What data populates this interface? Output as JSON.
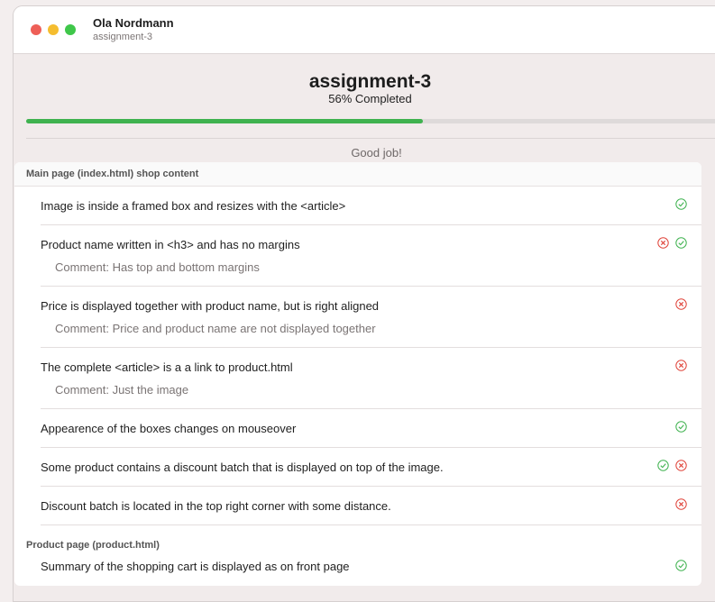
{
  "window": {
    "user_name": "Ola Nordmann",
    "assignment_id": "assignment-3"
  },
  "header": {
    "title": "assignment-3",
    "progress_text": "56% Completed",
    "progress_fraction": 0.56,
    "feedback": "Good job!"
  },
  "colors": {
    "progress_fill": "#3fb24f",
    "check_green": "#3fb24f",
    "cross_red": "#e0443a"
  },
  "sections": [
    {
      "title": "Main page (index.html) shop content",
      "criteria": [
        {
          "text": "Image is inside a framed box and resizes with the <article>",
          "comment": "",
          "icons": [
            "check-icon"
          ]
        },
        {
          "text": "Product name written in <h3> and has no margins",
          "comment": "Comment: Has top and bottom margins",
          "icons": [
            "cross-icon",
            "check-icon"
          ]
        },
        {
          "text": "Price is displayed together with product name, but is right aligned",
          "comment": "Comment: Price and product name are not displayed together",
          "icons": [
            "cross-icon"
          ]
        },
        {
          "text": "The complete <article> is a a link to product.html",
          "comment": "Comment: Just the image",
          "icons": [
            "cross-icon"
          ]
        },
        {
          "text": "Appearence of the boxes changes on mouseover",
          "comment": "",
          "icons": [
            "check-icon"
          ]
        },
        {
          "text": "Some product contains a discount batch that is displayed on top of the image.",
          "comment": "",
          "icons": [
            "check-icon",
            "cross-icon"
          ]
        },
        {
          "text": "Discount batch is located in the top right corner with some distance.",
          "comment": "",
          "icons": [
            "cross-icon"
          ]
        }
      ]
    },
    {
      "title": "Product page (product.html)",
      "criteria": [
        {
          "text": "Summary of the shopping cart is displayed as on front page",
          "comment": "",
          "icons": [
            "check-icon"
          ]
        }
      ]
    }
  ]
}
